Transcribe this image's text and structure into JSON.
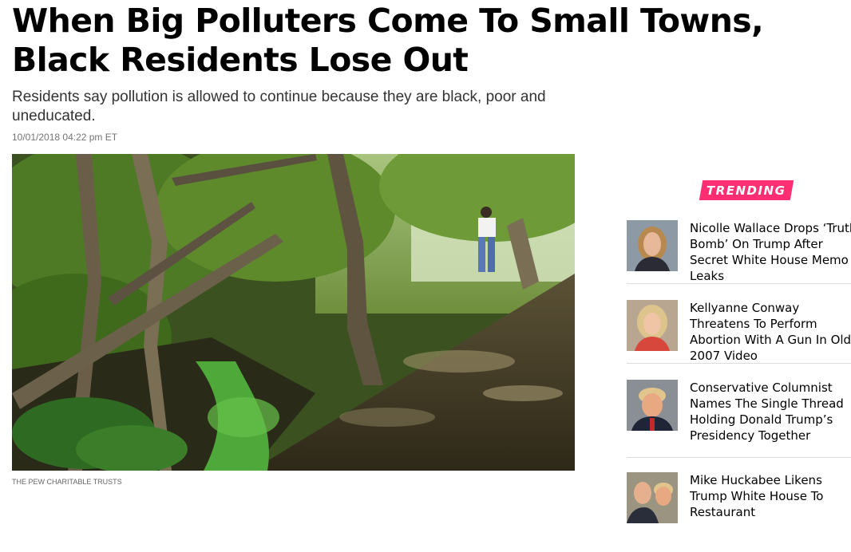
{
  "article": {
    "headline": "When Big Polluters Come To Small Towns, Black Residents Lose Out",
    "subheadline": "Residents say pollution is allowed to continue because they are black, poor and uneducated.",
    "timestamp": "10/01/2018 04:22 pm ET",
    "photo_credit": "THE PEW CHARITABLE TRUSTS"
  },
  "trending": {
    "label": "TRENDING",
    "badge_color": "#ff2e72",
    "items": [
      {
        "title": "Nicolle Wallace Drops ‘Truth Bomb’ On Trump After Secret White House Memo Leaks"
      },
      {
        "title": "Kellyanne Conway Threatens To Perform Abortion With A Gun In Old 2007 Video"
      },
      {
        "title": "Conservative Columnist Names The Single Thread Holding Donald Trump’s Presidency Together"
      },
      {
        "title": "Mike Huckabee Likens Trump White House To Restaurant"
      }
    ]
  }
}
